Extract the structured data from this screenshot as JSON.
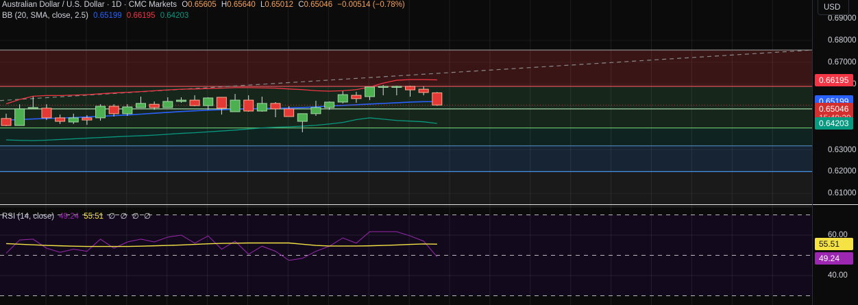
{
  "header": {
    "symbol": "Australian Dollar / U.S. Dollar · 1D · CMC Markets",
    "open_label": "O",
    "open": "0.65605",
    "high_label": "H",
    "high": "0.65640",
    "low_label": "L",
    "low": "0.65012",
    "close_label": "C",
    "close": "0.65046",
    "change": "−0.00514 (−0.78%)",
    "ohlc_color": "#f7a35c"
  },
  "bb_legend": {
    "label": "BB (20, SMA, close, 2.5)",
    "basis": "0.65199",
    "upper": "0.66195",
    "lower": "0.64203",
    "basis_color": "#2962ff",
    "upper_color": "#f23645",
    "lower_color": "#089981"
  },
  "rsi_legend": {
    "label": "RSI (14, close)",
    "rsi": "49.24",
    "ma": "55.51",
    "extras": [
      "∅",
      "∅",
      "∅",
      "∅"
    ],
    "rsi_color": "#9c27b0",
    "ma_color": "#f5e346"
  },
  "currency_button": "USD",
  "price_axis": {
    "ticks": [
      "0.69000",
      "0.68000",
      "0.67000",
      "0.66000",
      "0.63000",
      "0.62000",
      "0.61000"
    ],
    "tick_values": [
      0.69,
      0.68,
      0.67,
      0.66,
      0.63,
      0.62,
      0.61
    ],
    "tags": {
      "upper": "0.66195",
      "basis": "0.65199",
      "last": "0.65046",
      "countdown": "15:49:29",
      "lower": "0.64203"
    }
  },
  "rsi_axis": {
    "ticks": [
      "60.00",
      "40.00"
    ],
    "tags": {
      "ma": "55.51",
      "rsi": "49.24"
    }
  },
  "colors": {
    "up": "#4caf50",
    "down": "#e53935",
    "bg": "#0b0b0b"
  },
  "chart_data": [
    {
      "type": "candlestick",
      "title": "Australian Dollar / U.S. Dollar · 1D · CMC Markets",
      "ylim": [
        0.6035,
        0.6925
      ],
      "ohlc": [
        [
          0.6443,
          0.6465,
          0.6408,
          0.6411
        ],
        [
          0.6411,
          0.6508,
          0.6411,
          0.6487
        ],
        [
          0.6493,
          0.6543,
          0.649,
          0.6493
        ],
        [
          0.649,
          0.6508,
          0.6436,
          0.6446
        ],
        [
          0.6446,
          0.6461,
          0.6418,
          0.643
        ],
        [
          0.6427,
          0.6465,
          0.6418,
          0.6446
        ],
        [
          0.6446,
          0.6458,
          0.6414,
          0.6436
        ],
        [
          0.6446,
          0.6508,
          0.6433,
          0.6499
        ],
        [
          0.6499,
          0.6508,
          0.6452,
          0.6465
        ],
        [
          0.6465,
          0.6508,
          0.6455,
          0.6496
        ],
        [
          0.6493,
          0.6543,
          0.6493,
          0.6512
        ],
        [
          0.6508,
          0.6521,
          0.6483,
          0.6493
        ],
        [
          0.6493,
          0.654,
          0.6493,
          0.6521
        ],
        [
          0.6521,
          0.654,
          0.6515,
          0.6527
        ],
        [
          0.6527,
          0.6549,
          0.6499,
          0.6502
        ],
        [
          0.6502,
          0.654,
          0.6483,
          0.6537
        ],
        [
          0.654,
          0.654,
          0.6461,
          0.649
        ],
        [
          0.6474,
          0.6555,
          0.6474,
          0.6527
        ],
        [
          0.6527,
          0.6549,
          0.6474,
          0.6477
        ],
        [
          0.6477,
          0.6543,
          0.6474,
          0.6512
        ],
        [
          0.6512,
          0.6518,
          0.6449,
          0.6487
        ],
        [
          0.6487,
          0.6499,
          0.6452,
          0.6452
        ],
        [
          0.643,
          0.6465,
          0.638,
          0.6465
        ],
        [
          0.6465,
          0.6524,
          0.6455,
          0.6493
        ],
        [
          0.6493,
          0.6521,
          0.6483,
          0.6518
        ],
        [
          0.6518,
          0.6568,
          0.6512,
          0.6552
        ],
        [
          0.6549,
          0.6565,
          0.6515,
          0.6534
        ],
        [
          0.6543,
          0.6587,
          0.6527,
          0.6587
        ],
        [
          0.659,
          0.6596,
          0.6549,
          0.659
        ],
        [
          0.659,
          0.6593,
          0.6549,
          0.659
        ],
        [
          0.659,
          0.6593,
          0.6543,
          0.6574
        ],
        [
          0.6577,
          0.659,
          0.6549,
          0.6562
        ],
        [
          0.65605,
          0.6564,
          0.65012,
          0.65046
        ]
      ],
      "bb_upper": [
        0.651,
        0.653,
        0.6545,
        0.6548,
        0.6548,
        0.655,
        0.6552,
        0.6556,
        0.656,
        0.6563,
        0.6566,
        0.657,
        0.6574,
        0.6577,
        0.6578,
        0.658,
        0.6582,
        0.6584,
        0.6584,
        0.6583,
        0.6582,
        0.6578,
        0.6575,
        0.657,
        0.6568,
        0.657,
        0.6575,
        0.6587,
        0.6605,
        0.6618,
        0.6621,
        0.6621,
        0.66195
      ],
      "bb_basis": [
        0.6436,
        0.6438,
        0.6441,
        0.6443,
        0.6445,
        0.6447,
        0.645,
        0.6453,
        0.6456,
        0.6459,
        0.6463,
        0.6467,
        0.6471,
        0.6475,
        0.6478,
        0.6481,
        0.6483,
        0.6485,
        0.6487,
        0.6489,
        0.649,
        0.6491,
        0.6493,
        0.6496,
        0.65,
        0.6503,
        0.6506,
        0.6509,
        0.6512,
        0.6515,
        0.6518,
        0.652,
        0.65199
      ],
      "bb_lower": [
        0.6345,
        0.6343,
        0.6342,
        0.6344,
        0.6347,
        0.635,
        0.6353,
        0.6356,
        0.6359,
        0.6362,
        0.6364,
        0.6367,
        0.6371,
        0.6375,
        0.6378,
        0.6382,
        0.6386,
        0.639,
        0.6395,
        0.64,
        0.6403,
        0.6405,
        0.6408,
        0.6412,
        0.6418,
        0.6425,
        0.6438,
        0.6446,
        0.644,
        0.6434,
        0.6431,
        0.6428,
        0.64203
      ],
      "zones": [
        {
          "from": 0.659,
          "to": 0.6756,
          "color": "#3a1516"
        },
        {
          "from": 0.64,
          "to": 0.659,
          "color": "#16261b"
        },
        {
          "from": 0.6318,
          "to": 0.64,
          "color": "#0f2420"
        },
        {
          "from": 0.62,
          "to": 0.6318,
          "color": "#172434"
        },
        {
          "from": 0.6035,
          "to": 0.62,
          "color": "#1a1a1a"
        }
      ],
      "hlines": [
        {
          "value": 0.6756,
          "color": "#8a8a8a"
        },
        {
          "value": 0.659,
          "color": "#e0525a"
        },
        {
          "value": 0.6487,
          "color": "#a5d6a7"
        },
        {
          "value": 0.64,
          "color": "#66bb6a"
        },
        {
          "value": 0.6318,
          "color": "#4a7fb0"
        },
        {
          "value": 0.62,
          "color": "#4a90e2"
        }
      ],
      "trendline": {
        "start": 0.6525,
        "end": 0.6756,
        "color": "#8a8a8a"
      }
    },
    {
      "type": "line",
      "title": "RSI (14, close)",
      "ylim": [
        15,
        84
      ],
      "levels": [
        70,
        50,
        30
      ],
      "series": [
        {
          "name": "RSI",
          "color": "#9c27b0",
          "values": [
            51,
            57.6,
            58,
            53.5,
            51.5,
            53,
            52,
            58,
            53.5,
            56.6,
            58,
            56.6,
            59,
            60,
            56,
            59.6,
            53,
            57,
            50.5,
            54.5,
            52,
            47.5,
            48.5,
            52,
            54.5,
            58.6,
            56,
            61.7,
            61.7,
            61.7,
            59.6,
            57,
            49.24
          ]
        },
        {
          "name": "RSI-based MA",
          "color": "#f5e346",
          "values": [
            55.8,
            55.5,
            55.2,
            54.9,
            54.7,
            54.5,
            54.4,
            54.4,
            54.4,
            54.4,
            54.5,
            54.7,
            54.9,
            55.1,
            55.4,
            55.7,
            55.9,
            56.0,
            56.1,
            56.1,
            56.1,
            56.1,
            55.5,
            54.9,
            54.6,
            54.6,
            54.6,
            54.7,
            54.9,
            55.1,
            55.4,
            55.6,
            55.51
          ]
        }
      ]
    }
  ]
}
